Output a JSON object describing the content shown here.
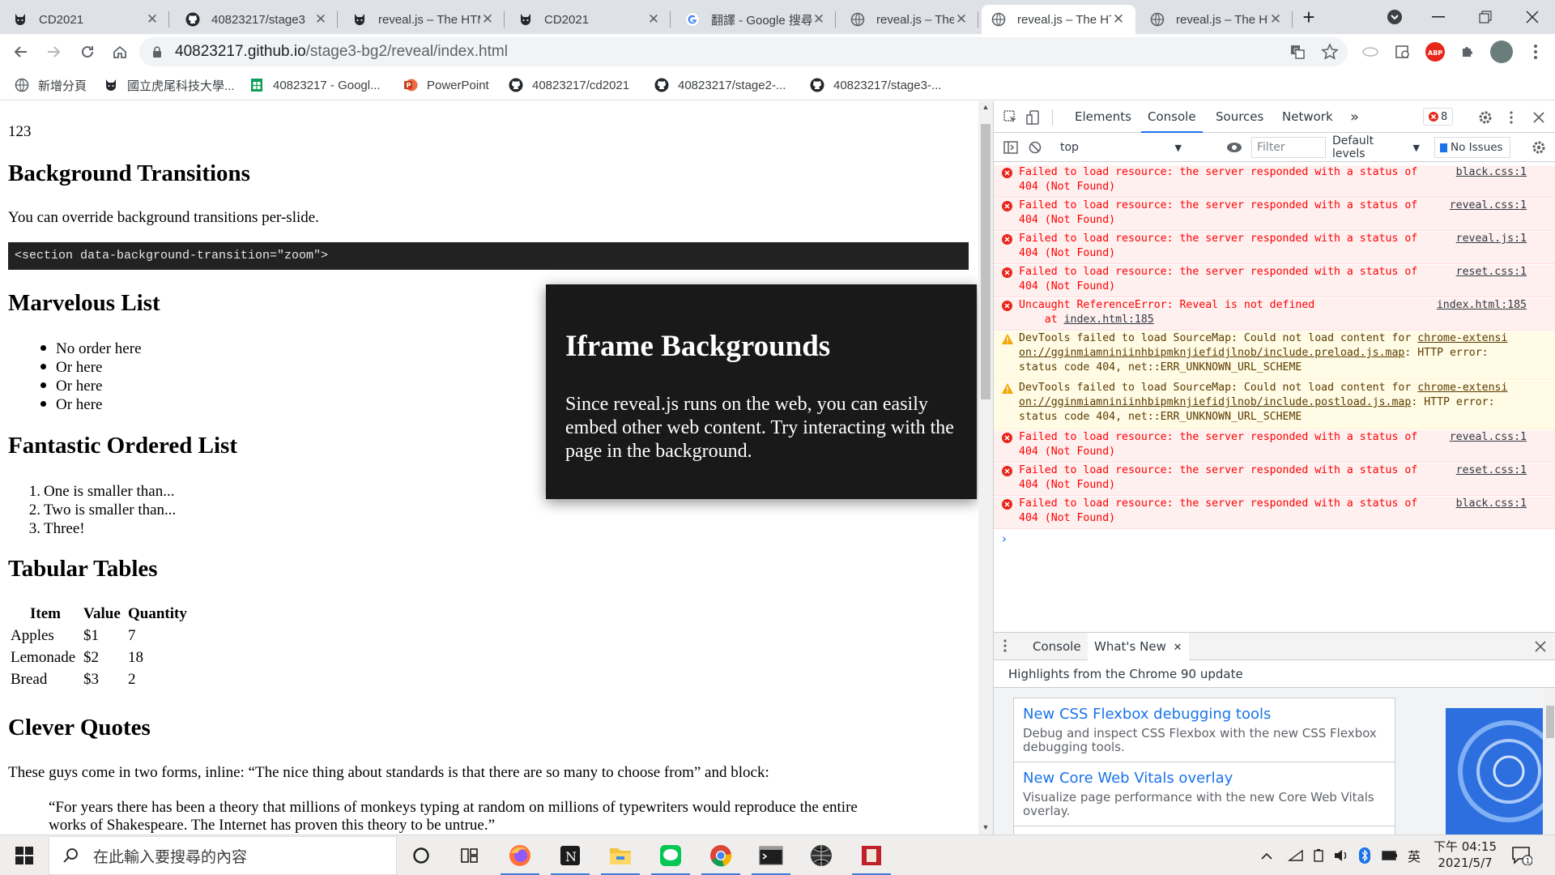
{
  "tabs": [
    {
      "title": "CD2021",
      "favicon": "github-cat-icon"
    },
    {
      "title": "40823217/stage3",
      "favicon": "github-icon"
    },
    {
      "title": "reveal.js – The HTML",
      "favicon": "github-cat-icon"
    },
    {
      "title": "CD2021",
      "favicon": "github-cat-icon"
    },
    {
      "title": "翻譯 - Google 搜尋",
      "favicon": "google-icon"
    },
    {
      "title": "reveal.js – The HTML",
      "favicon": "globe-icon"
    },
    {
      "title": "reveal.js – The HTML",
      "favicon": "globe-icon",
      "active": true
    },
    {
      "title": "reveal.js – The HTML",
      "favicon": "globe-icon"
    }
  ],
  "new_tab_label": "+",
  "address": {
    "host": "40823217.github.io",
    "path": "/stage3-bg2/reveal/index.html"
  },
  "bookmarks": [
    {
      "label": "新增分頁",
      "icon": "globe-icon"
    },
    {
      "label": "國立虎尾科技大學...",
      "icon": "github-cat-icon"
    },
    {
      "label": "40823217 - Googl...",
      "icon": "sheets-icon"
    },
    {
      "label": "PowerPoint",
      "icon": "powerpoint-icon"
    },
    {
      "label": "40823217/cd2021",
      "icon": "github-icon"
    },
    {
      "label": "40823217/stage2-...",
      "icon": "github-icon"
    },
    {
      "label": "40823217/stage3-...",
      "icon": "github-icon"
    }
  ],
  "page": {
    "top_text": "123",
    "bg_transitions": {
      "heading": "Background Transitions",
      "text": "You can override background transitions per-slide.",
      "code": "<section data-background-transition=\"zoom\">"
    },
    "marvelous": {
      "heading": "Marvelous List",
      "items": [
        "No order here",
        "Or here",
        "Or here",
        "Or here"
      ]
    },
    "ordered": {
      "heading": "Fantastic Ordered List",
      "items": [
        "One is smaller than...",
        "Two is smaller than...",
        "Three!"
      ],
      "numbers": [
        "1.",
        "2.",
        "3."
      ]
    },
    "tables": {
      "heading": "Tabular Tables",
      "headers": [
        "Item",
        "Value",
        "Quantity"
      ],
      "rows": [
        [
          "Apples",
          "$1",
          "7"
        ],
        [
          "Lemonade",
          "$2",
          "18"
        ],
        [
          "Bread",
          "$3",
          "2"
        ]
      ]
    },
    "quotes": {
      "heading": "Clever Quotes",
      "text": "These guys come in two forms, inline: “The nice thing about standards is that there are so many to choose from” and block:",
      "block_line1": "“For years there has been a theory that millions of monkeys typing at random on millions of typewriters would reproduce the entire",
      "block_line2": "works of Shakespeare. The Internet has proven this theory to be untrue.”"
    },
    "iframe_card": {
      "title": "Iframe Backgrounds",
      "body": "Since reveal.js runs on the web, you can easily embed other web content. Try interacting with the page in the background."
    }
  },
  "devtools": {
    "tabs": [
      "Elements",
      "Console",
      "Sources",
      "Network"
    ],
    "more_tabs": "»",
    "error_badge": "8",
    "context": "top",
    "filter_placeholder": "Filter",
    "levels": "Default levels",
    "issues": "No Issues",
    "messages": [
      {
        "type": "error",
        "line1": "Failed to load resource: the server responded with a status of",
        "line2": "404 (Not Found)",
        "source": "black.css:1"
      },
      {
        "type": "error",
        "line1": "Failed to load resource: the server responded with a status of",
        "line2": "404 (Not Found)",
        "source": "reveal.css:1"
      },
      {
        "type": "error",
        "line1": "Failed to load resource: the server responded with a status of",
        "line2": "404 (Not Found)",
        "source": "reveal.js:1"
      },
      {
        "type": "error",
        "line1": "Failed to load resource: the server responded with a status of",
        "line2": "404 (Not Found)",
        "source": "reset.css:1"
      },
      {
        "type": "error",
        "line1": "Uncaught ReferenceError: Reveal is not defined",
        "line2_prefix": "    at ",
        "line2_link": "index.html:185",
        "source": "index.html:185"
      },
      {
        "type": "warn",
        "line1_prefix": "DevTools failed to load SourceMap: Could not load content for ",
        "line1_link": "chrome-extensi",
        "line2_link": "on://gginmiamniniinhbipmknjiefidjlnob/include.preload.js.map",
        "line2_suffix": ": HTTP error:",
        "line3": "status code 404, net::ERR_UNKNOWN_URL_SCHEME"
      },
      {
        "type": "warn",
        "line1_prefix": "DevTools failed to load SourceMap: Could not load content for ",
        "line1_link": "chrome-extensi",
        "line2_link": "on://gginmiamniniinhbipmknjiefidjlnob/include.postload.js.map",
        "line2_suffix": ": HTTP error:",
        "line3": "status code 404, net::ERR_UNKNOWN_URL_SCHEME"
      },
      {
        "type": "error",
        "line1": "Failed to load resource: the server responded with a status of",
        "line2": "404 (Not Found)",
        "source": "reveal.css:1"
      },
      {
        "type": "error",
        "line1": "Failed to load resource: the server responded with a status of",
        "line2": "404 (Not Found)",
        "source": "reset.css:1"
      },
      {
        "type": "error",
        "line1": "Failed to load resource: the server responded with a status of",
        "line2": "404 (Not Found)",
        "source": "black.css:1"
      }
    ],
    "prompt": "›",
    "drawer": {
      "tabs": [
        "Console",
        "What's New"
      ],
      "subtitle": "Highlights from the Chrome 90 update",
      "cards": [
        {
          "title": "New CSS Flexbox debugging tools",
          "desc1": "Debug and inspect CSS Flexbox with the new CSS Flexbox",
          "desc2": "debugging tools."
        },
        {
          "title": "New Core Web Vitals overlay",
          "desc1": "Visualize page performance with the new Core Web Vitals",
          "desc2": "overlay."
        }
      ]
    }
  },
  "taskbar": {
    "search_placeholder": "在此輸入要搜尋的內容",
    "apps": [
      "cortana-icon",
      "task-view-icon",
      "firefox-icon",
      "notion-icon",
      "file-explorer-icon",
      "line-icon",
      "chrome-icon",
      "terminal-icon",
      "sphere-app-icon",
      "red-app-icon"
    ],
    "ime": "英",
    "time": "下午 04:15",
    "date": "2021/5/7",
    "notification_count": "1"
  },
  "colors": {
    "accent": "#1a73e8",
    "error": "#fe0000",
    "error_bg": "#fff0f0",
    "warn_bg": "#fffbe5",
    "code_bg": "#222222",
    "card_bg": "#191919"
  }
}
